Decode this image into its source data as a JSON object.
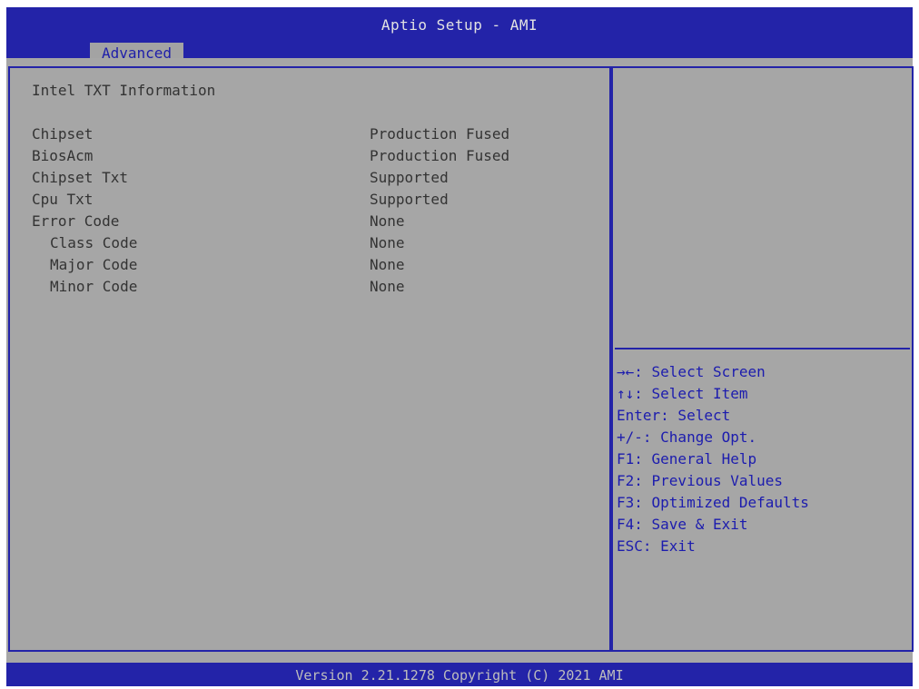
{
  "header": {
    "title": "Aptio Setup - AMI",
    "tabs": [
      {
        "label": "Advanced",
        "active": true
      }
    ]
  },
  "main": {
    "section_title": "Intel TXT Information",
    "rows": [
      {
        "label": "Chipset",
        "value": "Production Fused"
      },
      {
        "label": "BiosAcm",
        "value": "Production Fused"
      },
      {
        "label": "Chipset Txt",
        "value": "Supported"
      },
      {
        "label": "Cpu Txt",
        "value": "Supported"
      },
      {
        "label": "Error Code",
        "value": "None"
      },
      {
        "label": "Class Code",
        "value": "None"
      },
      {
        "label": "Major Code",
        "value": "None"
      },
      {
        "label": "Minor Code",
        "value": "None"
      }
    ]
  },
  "help": {
    "keys": [
      "→←: Select Screen",
      "↑↓: Select Item",
      "Enter: Select",
      "+/-: Change Opt.",
      "F1: General Help",
      "F2: Previous Values",
      "F3: Optimized Defaults",
      "F4: Save & Exit",
      "ESC: Exit"
    ]
  },
  "footer": {
    "version": "Version 2.21.1278 Copyright (C) 2021 AMI"
  },
  "colors": {
    "frame_blue": "#2323a8",
    "panel_gray": "#a6a6a6",
    "help_text": "#1c1cae",
    "body_text": "#333333"
  }
}
